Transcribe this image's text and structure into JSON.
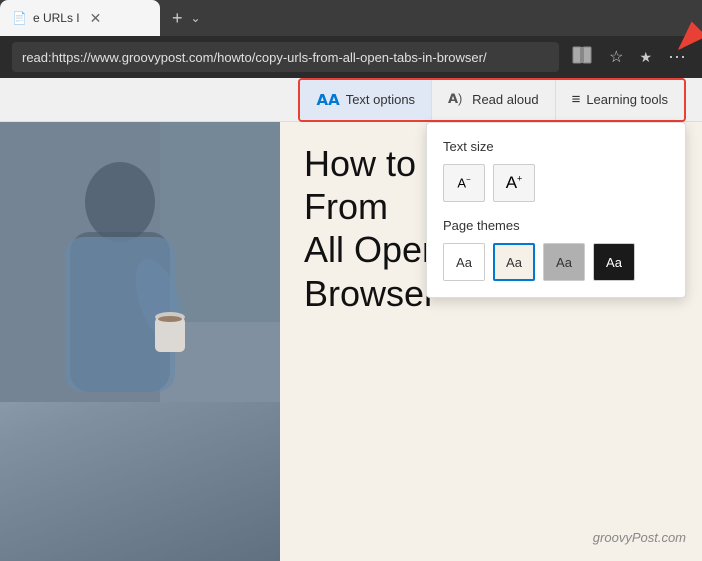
{
  "browser": {
    "tab": {
      "title": "e URLs I",
      "favicon": "📄"
    },
    "address": "read:https://www.groovypost.com/howto/copy-urls-from-all-open-tabs-in-browser/",
    "icons": {
      "immersive_reader": "🔲",
      "bookmark": "☆",
      "favorites": "★",
      "menu": "…"
    }
  },
  "reader_toolbar": {
    "text_options_label": "Text options",
    "read_aloud_label": "Read aloud",
    "learning_tools_label": "Learning tools"
  },
  "text_options_panel": {
    "text_size_section": "Text size",
    "page_themes_section": "Page themes",
    "themes": [
      {
        "label": "Aa",
        "style": "white",
        "selected": false
      },
      {
        "label": "Aa",
        "style": "light",
        "selected": true
      },
      {
        "label": "Aa",
        "style": "gray",
        "selected": false
      },
      {
        "label": "Aa",
        "style": "dark",
        "selected": false
      }
    ]
  },
  "article": {
    "title_line1": "How to Copy the URLs From",
    "title_line2": "All Open Tabs in Your",
    "title_line3": "Browser",
    "watermark": "groovyPost.com"
  }
}
